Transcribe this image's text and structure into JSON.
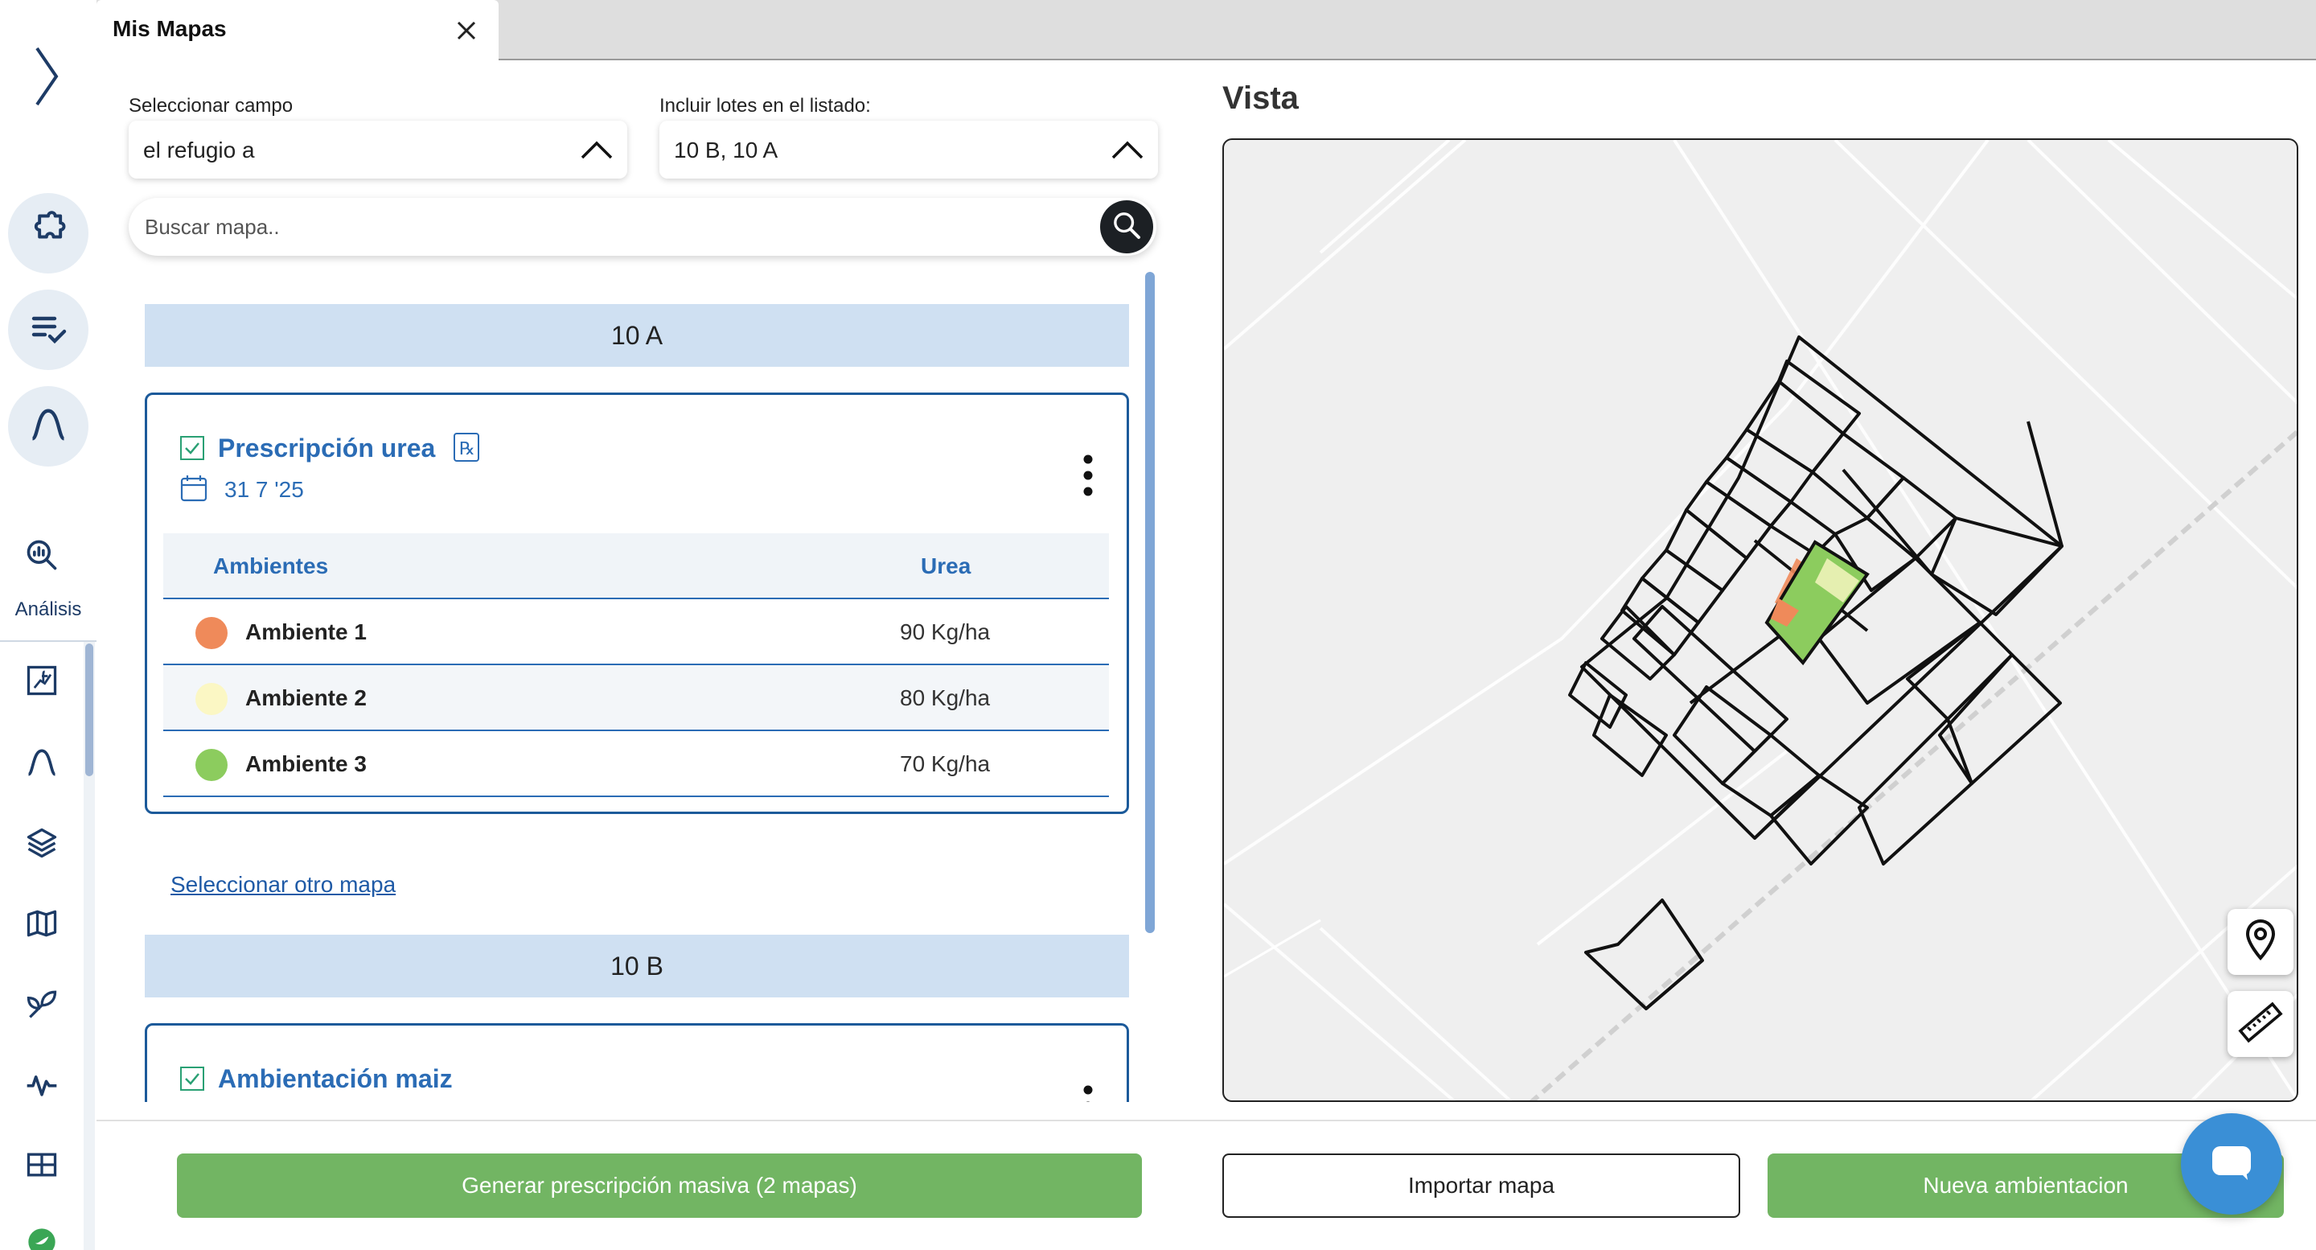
{
  "sidebar": {
    "items": [
      {
        "icon": "puzzle-icon"
      },
      {
        "icon": "checklist-icon"
      },
      {
        "icon": "curve-icon"
      }
    ],
    "analysis_label": "Análisis",
    "sub_items": [
      {
        "icon": "chart-fx-icon"
      },
      {
        "icon": "curve-icon"
      },
      {
        "icon": "layers-icon"
      },
      {
        "icon": "map-icon"
      },
      {
        "icon": "plant-icon"
      },
      {
        "icon": "pulse-icon"
      },
      {
        "icon": "grid-icon"
      }
    ]
  },
  "tab": {
    "title": "Mis Mapas"
  },
  "filters": {
    "campo_label": "Seleccionar campo",
    "campo_value": "el refugio a",
    "lotes_label": "Incluir lotes en el listado:",
    "lotes_value": "10 B, 10 A",
    "search_placeholder": "Buscar mapa.."
  },
  "groups": [
    {
      "name": "10 A",
      "card": {
        "title": "Prescripción urea",
        "date": "31 7 '25",
        "table": {
          "headers": [
            "Ambientes",
            "Urea"
          ],
          "rows": [
            {
              "name": "Ambiente 1",
              "value": "90 Kg/ha",
              "color": "#ef8a5a"
            },
            {
              "name": "Ambiente 2",
              "value": "80 Kg/ha",
              "color": "#fbf7c4"
            },
            {
              "name": "Ambiente 3",
              "value": "70 Kg/ha",
              "color": "#8ccc5e"
            }
          ]
        }
      },
      "link": "Seleccionar otro mapa"
    },
    {
      "name": "10 B",
      "card": {
        "title": "Ambientación maiz"
      }
    }
  ],
  "right": {
    "title": "Vista"
  },
  "footer": {
    "generate_label": "Generar prescripción masiva (2 mapas)",
    "import_label": "Importar mapa",
    "new_label": "Nueva ambientacion"
  },
  "colors": {
    "accent": "#2b6cb5",
    "green": "#72b563",
    "group_bg": "#cfe0f2"
  }
}
